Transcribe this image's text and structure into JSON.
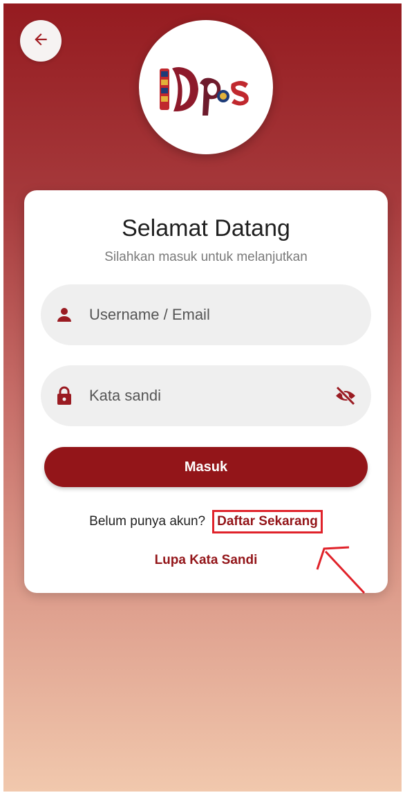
{
  "header": {
    "back_icon": "arrow-left-icon",
    "logo_text": "Dps"
  },
  "card": {
    "title": "Selamat Datang",
    "subtitle": "Silahkan masuk untuk melanjutkan"
  },
  "form": {
    "username": {
      "placeholder": "Username / Email",
      "value": "",
      "icon": "person-icon"
    },
    "password": {
      "placeholder": "Kata sandi",
      "value": "",
      "icon": "lock-icon",
      "toggle_icon": "eye-off-icon"
    },
    "login_label": "Masuk"
  },
  "footer_links": {
    "register_question": "Belum punya akun?",
    "register_link": "Daftar Sekarang",
    "forgot_link": "Lupa Kata Sandi"
  },
  "colors": {
    "primary": "#931519",
    "highlight": "#e0222a",
    "gradient_top": "#951b20",
    "gradient_bottom": "#f1c8ad"
  }
}
